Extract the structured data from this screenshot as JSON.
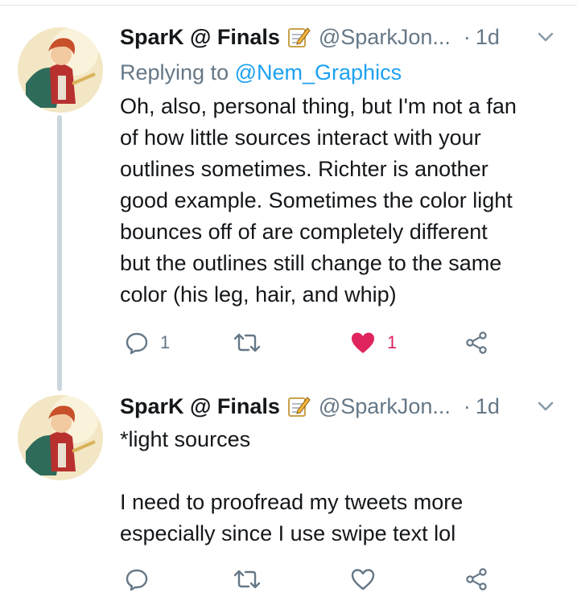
{
  "tweets": [
    {
      "author_name": "SparK @ Finals",
      "author_emoji": "memo-icon",
      "handle": "@SparkJon...",
      "dot": "·",
      "time": "1d",
      "replying_prefix": "Replying to ",
      "replying_handle": "@Nem_Graphics",
      "text": "Oh, also, personal thing, but I'm not a fan\nof how little sources interact with your\noutlines sometimes. Richter is another\ngood example. Sometimes the color light\nbounces off of are completely different\nbut the outlines still change to the same\ncolor (his leg, hair, and whip)",
      "reply_count": "1",
      "retweet_count": "",
      "like_count": "1",
      "liked": true
    },
    {
      "author_name": "SparK @ Finals",
      "author_emoji": "memo-icon",
      "handle": "@SparkJon...",
      "dot": "·",
      "time": "1d",
      "text": "*light sources\n\nI need to proofread my tweets more\nespecially since I use swipe text lol",
      "reply_count": "",
      "retweet_count": "",
      "like_count": "",
      "liked": false
    }
  ],
  "colors": {
    "text": "#14171a",
    "secondary": "#657786",
    "link": "#1da1f2",
    "like": "#e0245e",
    "thread_line": "#ccd6dd"
  }
}
